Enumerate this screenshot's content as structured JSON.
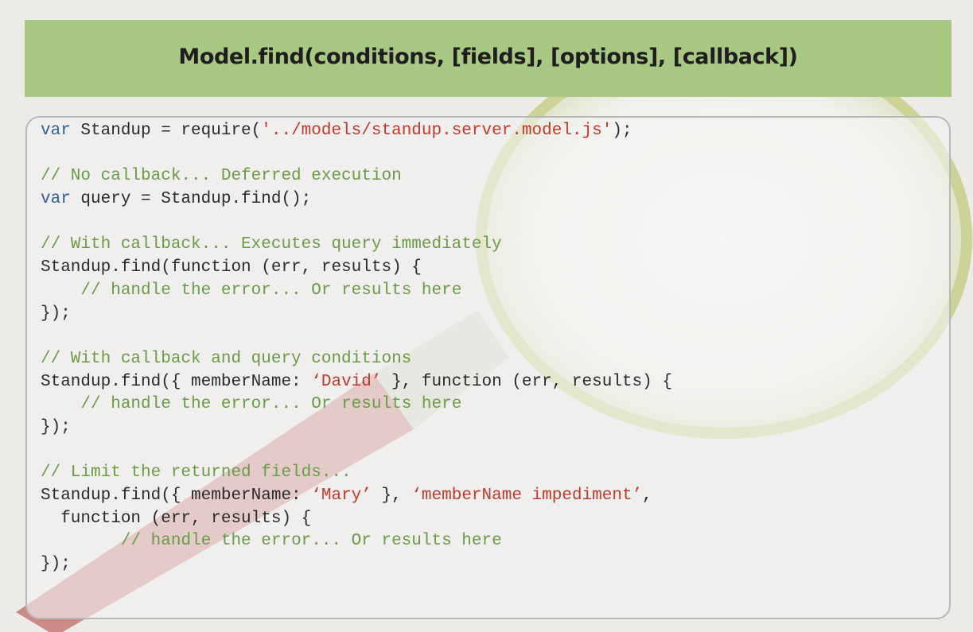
{
  "slide": {
    "title": "Model.find(conditions, [fields], [options], [callback])"
  },
  "colors": {
    "banner": "#a8c883",
    "keyword": "#2f5f9e",
    "string": "#c0392b",
    "comment": "#6a9a4a",
    "text": "#2a2a2a"
  },
  "background_graphic": "magnifying-glass",
  "code": {
    "language": "javascript",
    "lines": [
      [
        {
          "t": "kw",
          "v": "var"
        },
        {
          "t": "tx",
          "v": " Standup = require("
        },
        {
          "t": "str",
          "v": "'../models/standup.server.model.js'"
        },
        {
          "t": "tx",
          "v": ");"
        }
      ],
      [],
      [
        {
          "t": "cm",
          "v": "// No callback... Deferred execution"
        }
      ],
      [
        {
          "t": "kw",
          "v": "var"
        },
        {
          "t": "tx",
          "v": " query = Standup.find();"
        }
      ],
      [],
      [
        {
          "t": "cm",
          "v": "// With callback... Executes query immediately"
        }
      ],
      [
        {
          "t": "tx",
          "v": "Standup.find(function (err, results) {"
        }
      ],
      [
        {
          "t": "tx",
          "v": "    "
        },
        {
          "t": "cm",
          "v": "// handle the error... Or results here"
        }
      ],
      [
        {
          "t": "tx",
          "v": "});"
        }
      ],
      [],
      [
        {
          "t": "cm",
          "v": "// With callback and query conditions"
        }
      ],
      [
        {
          "t": "tx",
          "v": "Standup.find({ memberName: "
        },
        {
          "t": "str",
          "v": "‘David’"
        },
        {
          "t": "tx",
          "v": " }, function (err, results) {"
        }
      ],
      [
        {
          "t": "tx",
          "v": "    "
        },
        {
          "t": "cm",
          "v": "// handle the error... Or results here"
        }
      ],
      [
        {
          "t": "tx",
          "v": "});"
        }
      ],
      [],
      [
        {
          "t": "cm",
          "v": "// Limit the returned fields..."
        }
      ],
      [
        {
          "t": "tx",
          "v": "Standup.find({ memberName: "
        },
        {
          "t": "str",
          "v": "‘Mary’"
        },
        {
          "t": "tx",
          "v": " }, "
        },
        {
          "t": "str",
          "v": "‘memberName impediment’"
        },
        {
          "t": "tx",
          "v": ","
        }
      ],
      [
        {
          "t": "tx",
          "v": "  function (err, results) {"
        }
      ],
      [
        {
          "t": "tx",
          "v": "        "
        },
        {
          "t": "cm",
          "v": "// handle the error... Or results here"
        }
      ],
      [
        {
          "t": "tx",
          "v": "});"
        }
      ]
    ]
  }
}
